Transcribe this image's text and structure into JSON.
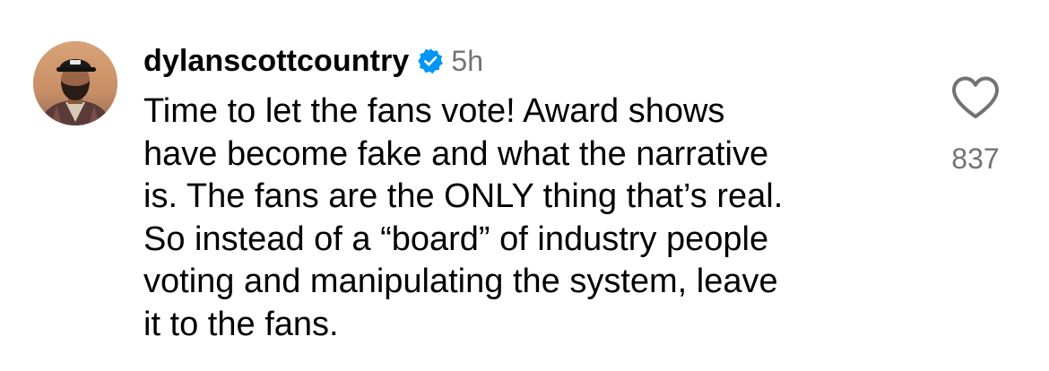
{
  "comment": {
    "username": "dylanscottcountry",
    "verified_icon": "verified-badge-icon",
    "timestamp": "5h",
    "text_lines": [
      "Time to let the fans vote! Award shows",
      "have become fake and what the narrative",
      "is. The fans are the ONLY thing that’s real.",
      "So instead of a “board” of industry people",
      "voting and manipulating the system, leave",
      "it to the fans."
    ],
    "like_icon": "heart-outline-icon",
    "like_count": "837"
  },
  "colors": {
    "text_primary": "#000000",
    "text_secondary": "#737373",
    "verified_blue": "#0095f6",
    "background": "#ffffff"
  }
}
